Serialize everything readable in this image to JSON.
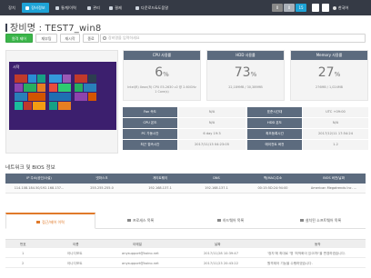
{
  "topbar": {
    "nav": [
      {
        "label": "장치"
      },
      {
        "label": "장비정보"
      },
      {
        "label": "통계/이력"
      },
      {
        "label": "관리"
      },
      {
        "label": "결제"
      },
      {
        "label": "다운로드&도움말"
      }
    ],
    "counts": [
      {
        "value": "0",
        "color": "#888888"
      },
      {
        "value": "0",
        "color": "#9aa0a6"
      },
      {
        "value": "15",
        "color": "#1ea3d6"
      }
    ],
    "icons": [
      "doc-icon",
      "gear-icon"
    ],
    "language": "한국어"
  },
  "title": {
    "prefix": "장비명",
    "name": "TEST7_win8"
  },
  "actions": {
    "remote": "원격 제어",
    "reboot": "재부팅",
    "restart": "재시작",
    "shutdown": "종료"
  },
  "search": {
    "placeholder": "장비명을 입력하세요"
  },
  "screen": {
    "start_label": "시작"
  },
  "usage": {
    "cpu": {
      "title": "CPU 사용률",
      "value": "6",
      "unit": "%",
      "desc": "Intel(R) Xeon(R) CPU E5-2630 v2 @ 2.60GHz 1 Core(s)"
    },
    "hdd": {
      "title": "HDD 사용률",
      "value": "73",
      "unit": "%",
      "desc": "22,189MB / 30,389MB"
    },
    "memory": {
      "title": "Memory 사용률",
      "value": "27",
      "unit": "%",
      "desc": "276MB / 1,024MB"
    }
  },
  "info": [
    {
      "label": "Fan 속도",
      "value": "N/A",
      "label2": "표준시간대",
      "value2": "UTC +09:00"
    },
    {
      "label": "CPU 온도",
      "value": "N/A",
      "label2": "HDD 온도",
      "value2": "N/A"
    },
    {
      "label": "PC 가동시간",
      "value": "6 day 19:3",
      "label2": "최초등록시간",
      "value2": "2017/12/11 17:54:24"
    },
    {
      "label": "최근 접속시간",
      "value": "2017/11/13 04:23:05",
      "label2": "에이전트 버전",
      "value2": "1.2"
    }
  ],
  "network": {
    "section_title": "네트워크 및 BIOS 정보",
    "headers": [
      "IP 주소(공인/사설)",
      "넷마스크",
      "게이트웨이",
      "DNS",
      "맥(MAC)주소",
      "BIOS 버전/날짜"
    ],
    "row": [
      "114.108.184.50/192.168.137...",
      "255.255.255.0",
      "192.168.137.1",
      "192.168.137.1",
      "00:15:5D:24:94:00",
      "American Megatrends Inc. ..."
    ]
  },
  "tabs": [
    {
      "label": "접근/제어 이력",
      "icon": "history-icon",
      "active": true
    },
    {
      "label": "프로세스 목록",
      "icon": "process-icon",
      "active": false
    },
    {
      "label": "하드웨어 목록",
      "icon": "hardware-icon",
      "active": false
    },
    {
      "label": "설치된 소프트웨어 목록",
      "icon": "software-icon",
      "active": false
    }
  ],
  "history": {
    "headers": [
      "번호",
      "이름",
      "이메일",
      "날짜",
      "동작"
    ],
    "rows": [
      [
        "1",
        "아나디포트",
        "anysupport@koino.net",
        "2017/11/28 10:39:47",
        "'정지'에 최대로 '명 '최적화이 있으며!'을 변경하였습니다."
      ],
      [
        "2",
        "아나디포트",
        "anysupport@koino.net",
        "2017/11/23 20:43:22",
        "원격제어 기능을 수행하였습니다."
      ]
    ]
  }
}
